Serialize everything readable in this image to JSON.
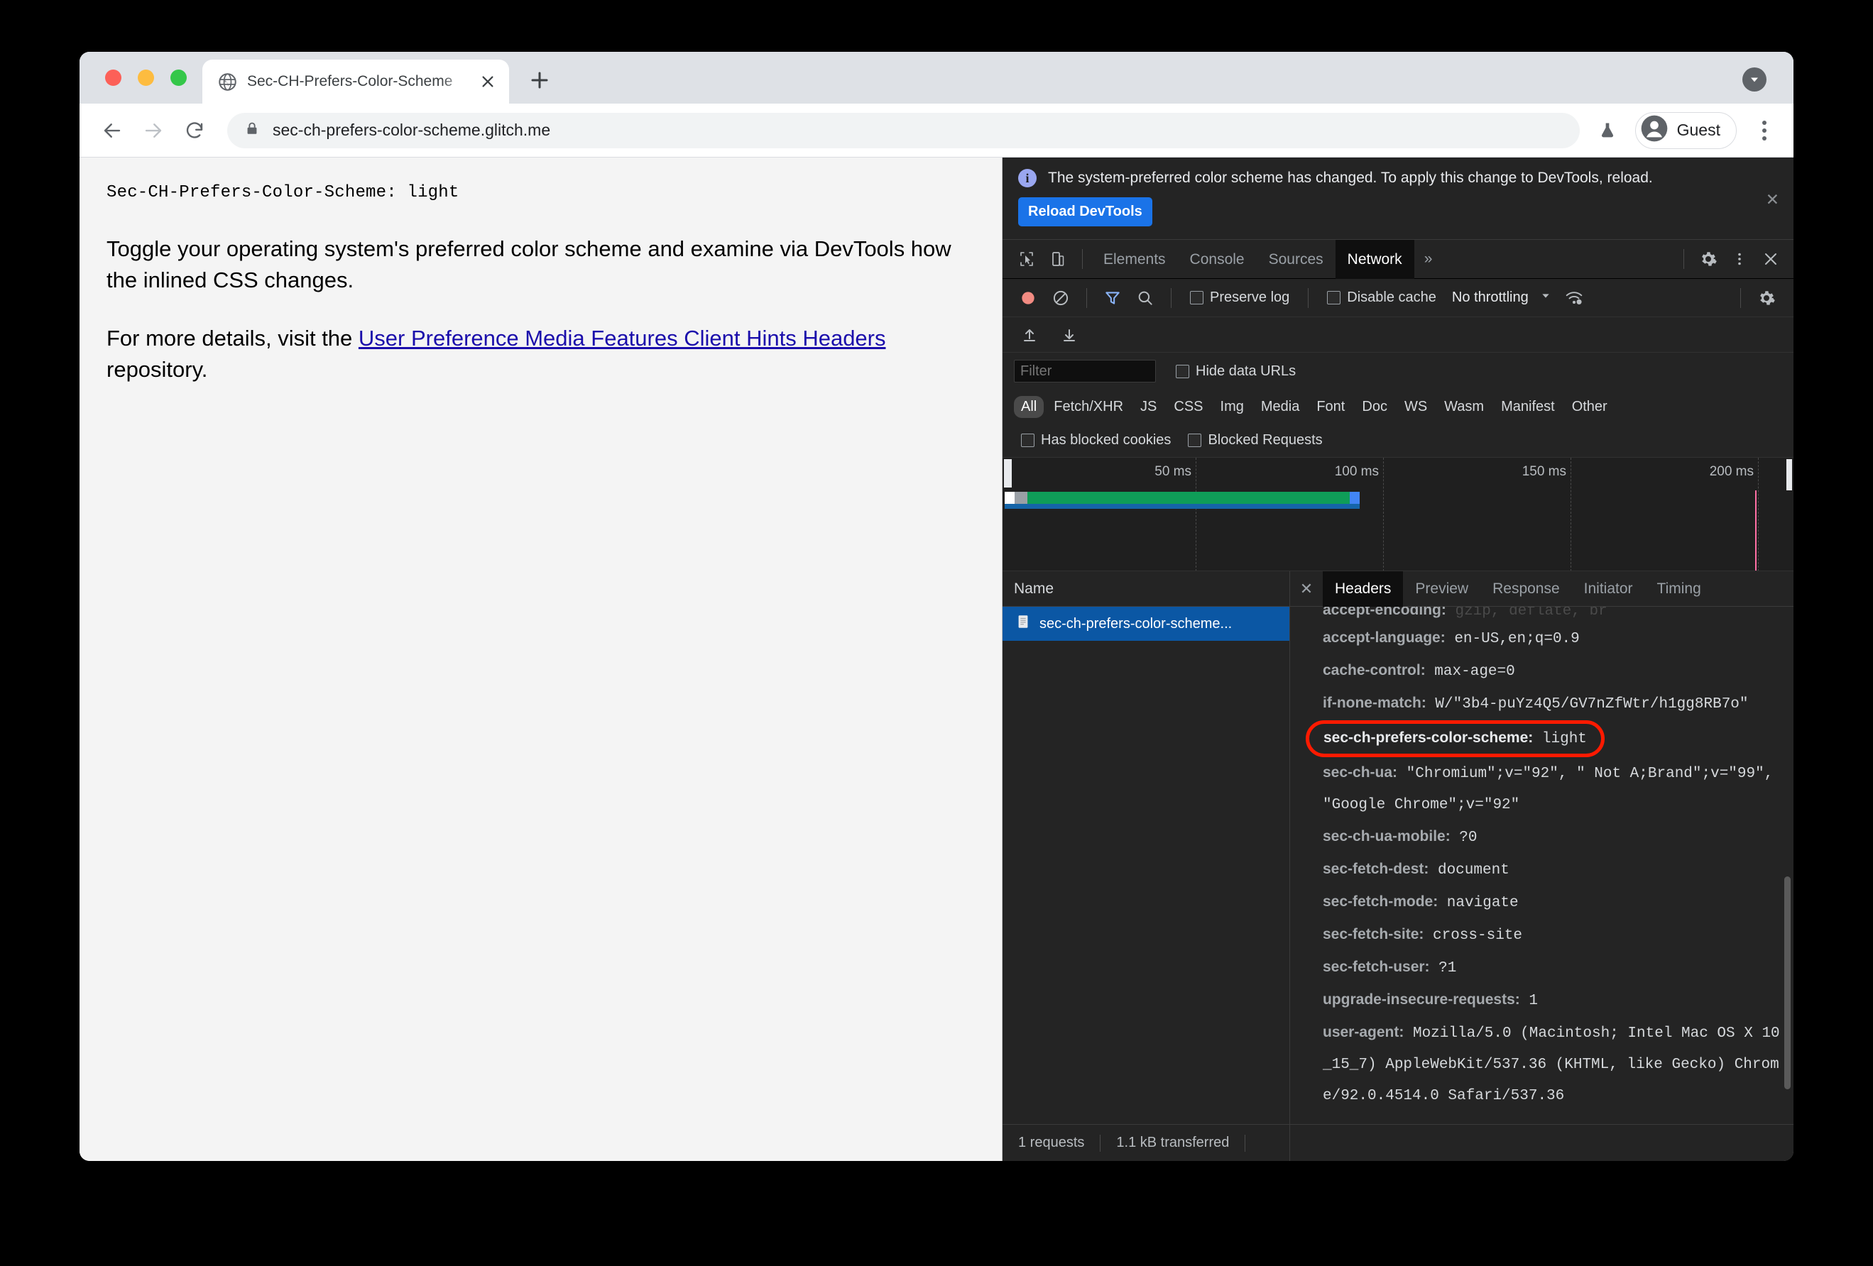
{
  "browser": {
    "tab": {
      "title": "Sec-CH-Prefers-Color-Scheme",
      "favicon": "globe-icon",
      "close": "close-icon"
    },
    "new_tab": "+",
    "tab_list_chevron": "chevron-down-icon",
    "nav": {
      "back": "back-arrow-icon",
      "forward": "forward-arrow-icon",
      "reload": "reload-icon"
    },
    "url": {
      "lock": "lock-icon",
      "value": "sec-ch-prefers-color-scheme.glitch.me"
    },
    "experiments_icon": "flask-icon",
    "profile": {
      "label": "Guest",
      "avatar": "account-circle-icon"
    },
    "menu": "kebab-menu-icon"
  },
  "page": {
    "header_code": "Sec-CH-Prefers-Color-Scheme: light",
    "intro": "Toggle your operating system's preferred color scheme and examine via DevTools how the inlined CSS changes.",
    "details_prefix": "For more details, visit the ",
    "details_link": "User Preference Media Features Client Hints Headers",
    "details_suffix": " repository."
  },
  "devtools": {
    "infobar": {
      "icon": "info-icon",
      "message": "The system-preferred color scheme has changed. To apply this change to DevTools, reload.",
      "button": "Reload DevTools",
      "close": "close-icon"
    },
    "tabbar": {
      "inspect_icon": "inspect-cursor-icon",
      "device_icon": "device-toolbar-icon",
      "tabs": [
        {
          "label": "Elements",
          "active": false
        },
        {
          "label": "Console",
          "active": false
        },
        {
          "label": "Sources",
          "active": false
        },
        {
          "label": "Network",
          "active": true
        }
      ],
      "more": "»",
      "settings_icon": "gear-icon",
      "kebab_icon": "kebab-menu-icon",
      "close_icon": "close-icon"
    },
    "network_toolbar": {
      "record_icon": "record-stop-icon",
      "clear_icon": "clear-icon",
      "filter_icon": "funnel-icon",
      "search_icon": "search-icon",
      "preserve_log": "Preserve log",
      "disable_cache": "Disable cache",
      "throttling": "No throttling",
      "throttle_chevron": "chevron-down-icon",
      "wifi_icon": "network-conditions-icon",
      "settings_icon": "gear-icon",
      "import_icon": "import-har-icon",
      "export_icon": "export-har-icon"
    },
    "filters": {
      "filter_placeholder": "Filter",
      "filter_value": "",
      "hide_data_urls": "Hide data URLs",
      "types": [
        "All",
        "Fetch/XHR",
        "JS",
        "CSS",
        "Img",
        "Media",
        "Font",
        "Doc",
        "WS",
        "Wasm",
        "Manifest",
        "Other"
      ],
      "active_type": "All",
      "has_blocked_cookies": "Has blocked cookies",
      "blocked_requests": "Blocked Requests"
    },
    "timeline": {
      "ticks": [
        "50 ms",
        "100 ms",
        "150 ms",
        "200 ms"
      ]
    },
    "request_list": {
      "column_header": "Name",
      "rows": [
        {
          "name": "sec-ch-prefers-color-scheme...",
          "icon": "document-icon",
          "selected": true
        }
      ]
    },
    "details": {
      "close": "close-icon",
      "tabs": [
        {
          "label": "Headers",
          "active": true
        },
        {
          "label": "Preview",
          "active": false
        },
        {
          "label": "Response",
          "active": false
        },
        {
          "label": "Initiator",
          "active": false
        },
        {
          "label": "Timing",
          "active": false
        }
      ],
      "headers": [
        {
          "name": "accept-encoding:",
          "value": " gzip, deflate, br",
          "clipped": true,
          "highlight": false
        },
        {
          "name": "accept-language:",
          "value": " en-US,en;q=0.9",
          "clipped": false,
          "highlight": false
        },
        {
          "name": "cache-control:",
          "value": " max-age=0",
          "clipped": false,
          "highlight": false
        },
        {
          "name": "if-none-match:",
          "value": " W/\"3b4-puYz4Q5/GV7nZfWtr/h1gg8RB7o\"",
          "clipped": false,
          "highlight": false
        },
        {
          "name": "sec-ch-prefers-color-scheme:",
          "value": " light",
          "clipped": false,
          "highlight": true
        },
        {
          "name": "sec-ch-ua:",
          "value": " \"Chromium\";v=\"92\", \" Not A;Brand\";v=\"99\", \"Google Chrome\";v=\"92\"",
          "clipped": false,
          "highlight": false
        },
        {
          "name": "sec-ch-ua-mobile:",
          "value": " ?0",
          "clipped": false,
          "highlight": false
        },
        {
          "name": "sec-fetch-dest:",
          "value": " document",
          "clipped": false,
          "highlight": false
        },
        {
          "name": "sec-fetch-mode:",
          "value": " navigate",
          "clipped": false,
          "highlight": false
        },
        {
          "name": "sec-fetch-site:",
          "value": " cross-site",
          "clipped": false,
          "highlight": false
        },
        {
          "name": "sec-fetch-user:",
          "value": " ?1",
          "clipped": false,
          "highlight": false
        },
        {
          "name": "upgrade-insecure-requests:",
          "value": " 1",
          "clipped": false,
          "highlight": false
        },
        {
          "name": "user-agent:",
          "value": " Mozilla/5.0 (Macintosh; Intel Mac OS X 10_15_7) AppleWebKit/537.36 (KHTML, like Gecko) Chrome/92.0.4514.0 Safari/537.36",
          "clipped": false,
          "highlight": false
        }
      ]
    },
    "status_bar": {
      "requests": "1 requests",
      "transferred": "1.1 kB transferred"
    }
  },
  "colors": {
    "accent_blue": "#1a73e8",
    "selection_blue": "#0b57a4",
    "highlight_red": "#ff1a00",
    "link_blue": "#1a0dab",
    "timeline_green": "#0f9d58"
  }
}
